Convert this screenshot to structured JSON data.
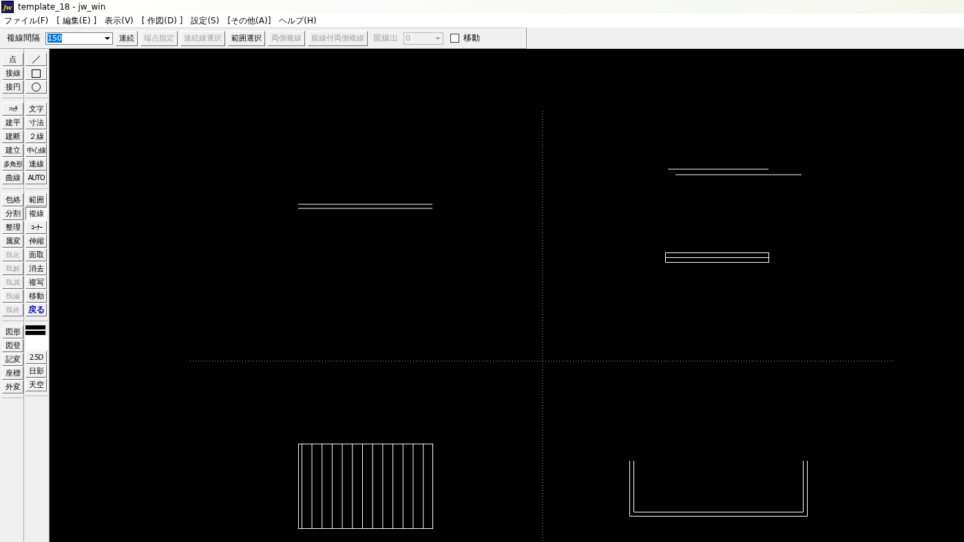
{
  "window": {
    "title": "template_18 - jw_win",
    "app_icon": "jw"
  },
  "menu": [
    "ファイル(F)",
    "[ 編集(E) ]",
    "表示(V)",
    "[ 作図(D) ]",
    "設定(S)",
    "[その他(A)]",
    "ヘルプ(H)"
  ],
  "toolbar": [
    {
      "kind": "label",
      "text": "複線間隔",
      "disabled": false
    },
    {
      "kind": "combo",
      "value": "150",
      "disabled": false,
      "selected": true
    },
    {
      "kind": "button",
      "text": "連続",
      "disabled": false
    },
    {
      "kind": "button",
      "text": "端点指定",
      "disabled": true
    },
    {
      "kind": "button",
      "text": "連続線選択",
      "disabled": true
    },
    {
      "kind": "button",
      "text": "範囲選択",
      "disabled": false
    },
    {
      "kind": "button",
      "text": "両側複線",
      "disabled": true
    },
    {
      "kind": "button",
      "text": "留線付両側複線",
      "disabled": true
    },
    {
      "kind": "label",
      "text": "留線出",
      "disabled": true
    },
    {
      "kind": "combo",
      "value": "0",
      "disabled": true,
      "selected": false
    },
    {
      "kind": "checkbox",
      "text": "移動",
      "checked": false,
      "disabled": false
    }
  ],
  "left_toolbar": {
    "columns": [
      [
        [
          {
            "kind": "text",
            "label": "点",
            "disabled": false,
            "selected": false
          },
          {
            "kind": "text",
            "label": "接線",
            "disabled": false,
            "selected": false
          },
          {
            "kind": "text",
            "label": "接円",
            "disabled": false,
            "selected": false
          }
        ],
        [
          {
            "kind": "text",
            "label": "ﾊｯﾁ",
            "disabled": false,
            "selected": false
          },
          {
            "kind": "text",
            "label": "建平",
            "disabled": false,
            "selected": false
          },
          {
            "kind": "text",
            "label": "建断",
            "disabled": false,
            "selected": false
          },
          {
            "kind": "text",
            "label": "建立",
            "disabled": false,
            "selected": false
          },
          {
            "kind": "text",
            "label": "多角形",
            "disabled": false,
            "selected": false
          },
          {
            "kind": "text",
            "label": "曲線",
            "disabled": false,
            "selected": false
          }
        ],
        [
          {
            "kind": "text",
            "label": "包絡",
            "disabled": false,
            "selected": false
          },
          {
            "kind": "text",
            "label": "分割",
            "disabled": false,
            "selected": false
          },
          {
            "kind": "text",
            "label": "整理",
            "disabled": false,
            "selected": false
          },
          {
            "kind": "text",
            "label": "属変",
            "disabled": false,
            "selected": false
          },
          {
            "kind": "text",
            "label": "BL化",
            "disabled": true,
            "selected": false
          },
          {
            "kind": "text",
            "label": "BL解",
            "disabled": true,
            "selected": false
          },
          {
            "kind": "text",
            "label": "BL属",
            "disabled": true,
            "selected": false
          },
          {
            "kind": "text",
            "label": "BL編",
            "disabled": true,
            "selected": false
          },
          {
            "kind": "text",
            "label": "BL終",
            "disabled": true,
            "selected": false
          }
        ],
        [
          {
            "kind": "text",
            "label": "図形",
            "disabled": false,
            "selected": false
          },
          {
            "kind": "text",
            "label": "図登",
            "disabled": false,
            "selected": false
          },
          {
            "kind": "text",
            "label": "記変",
            "disabled": false,
            "selected": false
          },
          {
            "kind": "text",
            "label": "座標",
            "disabled": false,
            "selected": false
          },
          {
            "kind": "text",
            "label": "外変",
            "disabled": false,
            "selected": false
          }
        ]
      ],
      [
        [
          {
            "kind": "line",
            "disabled": false,
            "selected": false
          },
          {
            "kind": "rectangle",
            "disabled": false,
            "selected": false
          },
          {
            "kind": "circle",
            "disabled": false,
            "selected": false
          }
        ],
        [
          {
            "kind": "text",
            "label": "文字",
            "disabled": false,
            "selected": false
          },
          {
            "kind": "text",
            "label": "寸法",
            "disabled": false,
            "selected": false
          },
          {
            "kind": "text",
            "label": "２線",
            "disabled": false,
            "selected": false
          },
          {
            "kind": "text",
            "label": "中心線",
            "disabled": false,
            "selected": false
          },
          {
            "kind": "text",
            "label": "連線",
            "disabled": false,
            "selected": false
          },
          {
            "kind": "text",
            "label": "AUTO",
            "disabled": false,
            "selected": false
          }
        ],
        [
          {
            "kind": "text",
            "label": "範囲",
            "disabled": false,
            "selected": false
          },
          {
            "kind": "text",
            "label": "複線",
            "disabled": false,
            "selected": true
          },
          {
            "kind": "text",
            "label": "ｺｰﾅｰ",
            "disabled": false,
            "selected": false
          },
          {
            "kind": "text",
            "label": "伸縮",
            "disabled": false,
            "selected": false
          },
          {
            "kind": "text",
            "label": "面取",
            "disabled": false,
            "selected": false
          },
          {
            "kind": "text",
            "label": "消去",
            "disabled": false,
            "selected": false
          },
          {
            "kind": "text",
            "label": "複写",
            "disabled": false,
            "selected": false
          },
          {
            "kind": "text",
            "label": "移動",
            "disabled": false,
            "selected": false
          },
          {
            "kind": "text",
            "label": "戻る",
            "disabled": false,
            "selected": false,
            "color": "#0000cc"
          }
        ],
        [
          {
            "kind": "swatch"
          },
          {
            "kind": "blank"
          },
          {
            "kind": "text",
            "label": "2.5D",
            "disabled": false,
            "selected": false
          },
          {
            "kind": "text",
            "label": "日影",
            "disabled": false,
            "selected": false
          },
          {
            "kind": "text",
            "label": "天空",
            "disabled": false,
            "selected": false
          }
        ]
      ]
    ]
  }
}
